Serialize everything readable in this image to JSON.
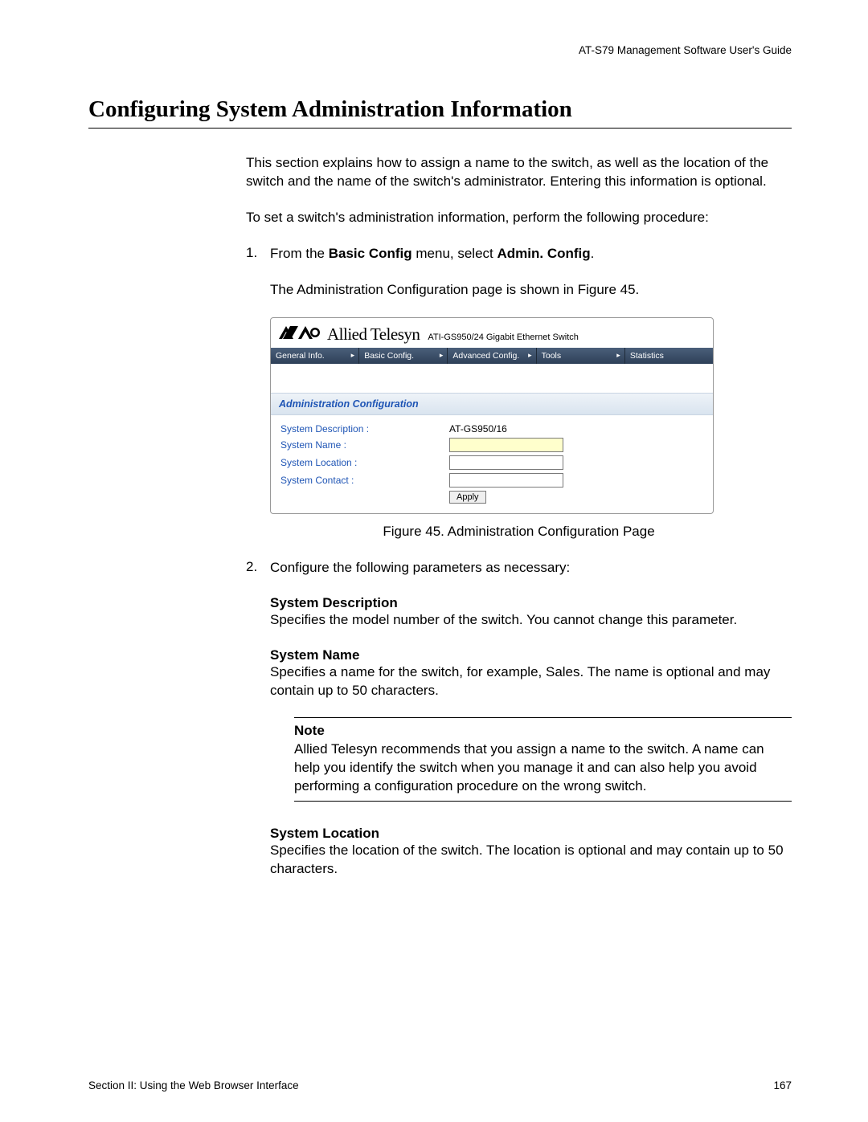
{
  "header": {
    "guide_title": "AT-S79 Management Software User's Guide"
  },
  "title": "Configuring System Administration Information",
  "intro1": "This section explains how to assign a name to the switch, as well as the location of the switch and the name of the switch's administrator. Entering this information is optional.",
  "intro2": "To set a switch's administration information, perform the following procedure:",
  "step1": {
    "num": "1.",
    "text_prefix": "From the ",
    "bold1": "Basic Config",
    "text_mid": " menu, select ",
    "bold2": "Admin. Config",
    "text_suffix": ".",
    "followup": "The Administration Configuration page is shown in Figure 45."
  },
  "shot": {
    "brand": "Allied Telesyn",
    "product": "ATI-GS950/24 Gigabit Ethernet Switch",
    "menu": [
      "General Info.",
      "Basic Config.",
      "Advanced Config.",
      "Tools",
      "Statistics"
    ],
    "panel_title": "Administration Configuration",
    "rows": {
      "desc_label": "System Description :",
      "desc_value": "AT-GS950/16",
      "name_label": "System Name :",
      "loc_label": "System Location :",
      "contact_label": "System Contact :"
    },
    "apply": "Apply"
  },
  "figure_caption": "Figure 45. Administration Configuration Page",
  "step2": {
    "num": "2.",
    "text": "Configure the following parameters as necessary:"
  },
  "params": {
    "sys_desc_h": "System Description",
    "sys_desc_t": "Specifies the model number of the switch. You cannot change this parameter.",
    "sys_name_h": "System Name",
    "sys_name_t": "Specifies a name for the switch, for example, Sales. The name is optional and may contain up to 50 characters.",
    "sys_loc_h": "System Location",
    "sys_loc_t": "Specifies the location of the switch. The location is optional and may contain up to 50 characters."
  },
  "note": {
    "heading": "Note",
    "text": "Allied Telesyn recommends that you assign a name to the switch. A name can help you identify the switch when you manage it and can also help you avoid performing a configuration procedure on the wrong switch."
  },
  "footer": {
    "section": "Section II: Using the Web Browser Interface",
    "page": "167"
  }
}
